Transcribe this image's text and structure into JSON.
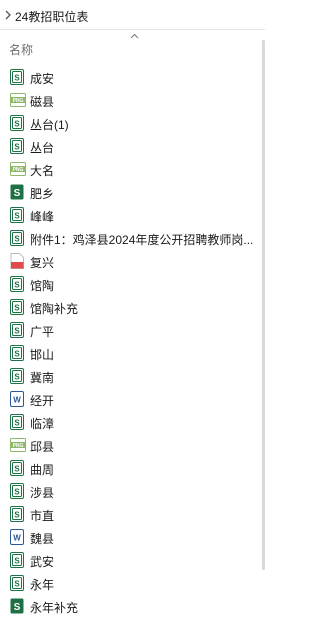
{
  "breadcrumb": {
    "folder": "24教招职位表"
  },
  "header": {
    "name_column": "名称"
  },
  "colors": {
    "sheet_green": "#1e7145",
    "doc_blue": "#2b579a",
    "png_green": "#8fb86a",
    "pdf_red": "#e04a4a"
  },
  "files": [
    {
      "name": "成安",
      "icon": "spreadsheet-file-icon"
    },
    {
      "name": "磁县",
      "icon": "image-file-icon"
    },
    {
      "name": "丛台(1)",
      "icon": "spreadsheet-file-icon"
    },
    {
      "name": "丛台",
      "icon": "spreadsheet-file-icon"
    },
    {
      "name": "大名",
      "icon": "image-file-icon"
    },
    {
      "name": "肥乡",
      "icon": "wps-spreadsheet-file-icon"
    },
    {
      "name": "峰峰",
      "icon": "spreadsheet-file-icon"
    },
    {
      "name": "附件1：鸡泽县2024年度公开招聘教师岗...",
      "icon": "spreadsheet-file-icon"
    },
    {
      "name": "复兴",
      "icon": "pdf-file-icon"
    },
    {
      "name": "馆陶",
      "icon": "spreadsheet-file-icon"
    },
    {
      "name": "馆陶补充",
      "icon": "spreadsheet-file-icon"
    },
    {
      "name": "广平",
      "icon": "spreadsheet-file-icon"
    },
    {
      "name": "邯山",
      "icon": "spreadsheet-file-icon"
    },
    {
      "name": "冀南",
      "icon": "spreadsheet-file-icon"
    },
    {
      "name": "经开",
      "icon": "word-file-icon"
    },
    {
      "name": "临漳",
      "icon": "spreadsheet-file-icon"
    },
    {
      "name": "邱县",
      "icon": "image-file-icon"
    },
    {
      "name": "曲周",
      "icon": "spreadsheet-file-icon"
    },
    {
      "name": "涉县",
      "icon": "spreadsheet-file-icon"
    },
    {
      "name": "市直",
      "icon": "spreadsheet-file-icon"
    },
    {
      "name": "魏县",
      "icon": "word-file-icon"
    },
    {
      "name": "武安",
      "icon": "spreadsheet-file-icon"
    },
    {
      "name": "永年",
      "icon": "spreadsheet-file-icon"
    },
    {
      "name": "永年补充",
      "icon": "wps-spreadsheet-file-icon"
    }
  ]
}
